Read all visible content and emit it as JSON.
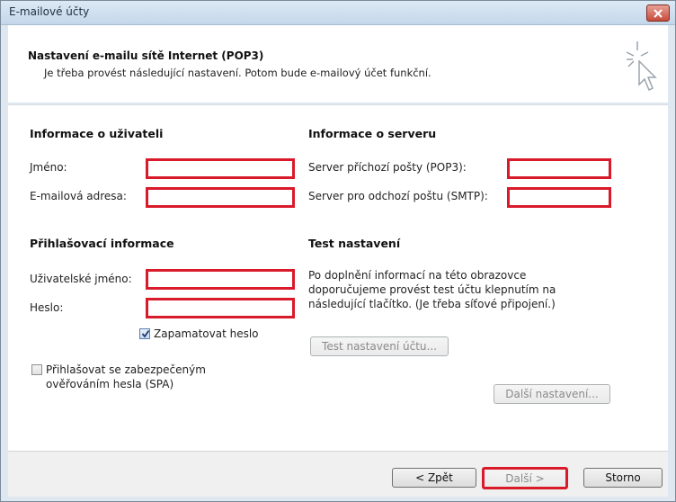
{
  "window": {
    "title": "E-mailové účty"
  },
  "header": {
    "title": "Nastavení e-mailu sítě Internet (POP3)",
    "subtitle": "Je třeba provést následující nastavení. Potom bude e-mailový účet funkční.",
    "icon": "cursor-sparkle-icon"
  },
  "user_info": {
    "heading": "Informace o uživateli",
    "name_label": "Jméno:",
    "email_label": "E-mailová adresa:"
  },
  "server_info": {
    "heading": "Informace o serveru",
    "incoming_label": "Server příchozí pošty (POP3):",
    "outgoing_label": "Server pro odchozí poštu (SMTP):"
  },
  "login_info": {
    "heading": "Přihlašovací informace",
    "username_label": "Uživatelské jméno:",
    "password_label": "Heslo:",
    "remember_label": "Zapamatovat heslo",
    "remember_checked": true,
    "spa_label_line1": "Přihlašovat se zabezpečeným",
    "spa_label_line2": "ověřováním hesla (SPA)",
    "spa_checked": false
  },
  "test_settings": {
    "heading": "Test nastavení",
    "description_line1": "Po doplnění informací na této obrazovce",
    "description_line2": "doporučujeme provést test účtu klepnutím na",
    "description_line3": "následující tlačítko. (Je třeba síťové připojení.)",
    "test_button": "Test nastavení účtu...",
    "more_button": "Další nastavení..."
  },
  "footer": {
    "back_button": "< Zpět",
    "next_button": "Další >",
    "cancel_button": "Storno"
  },
  "colors": {
    "highlight": "#d91a2a",
    "window_border": "#7a8a99"
  }
}
